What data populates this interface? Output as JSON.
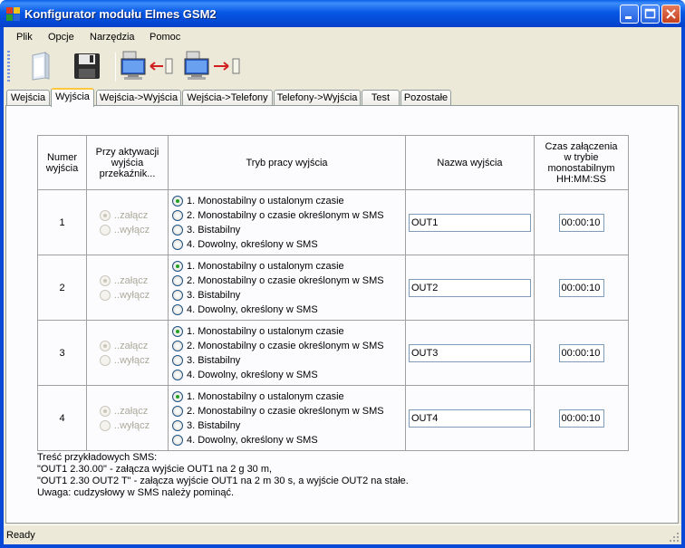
{
  "window": {
    "title": "Konfigurator modułu Elmes GSM2"
  },
  "menu": [
    "Plik",
    "Opcje",
    "Narzędzia",
    "Pomoc"
  ],
  "toolbar": {
    "buttons": [
      "open-icon",
      "save-icon",
      "read-from-device-icon",
      "write-to-device-icon"
    ]
  },
  "tabs": [
    "Wejścia",
    "Wyjścia",
    "Wejścia->Wyjścia",
    "Wejścia->Telefony",
    "Telefony->Wyjścia",
    "Test",
    "Pozostałe"
  ],
  "active_tab": "Wyjścia",
  "table": {
    "headers": {
      "number": "Numer wyjścia",
      "relay": "Przy aktywacji wyjścia przekaźnik...",
      "mode": "Tryb pracy wyjścia",
      "name": "Nazwa wyjścia",
      "time": "Czas załączenia w trybie monostabilnym HH:MM:SS"
    },
    "relay_options": [
      "..załącz",
      "..wyłącz"
    ],
    "mode_options": [
      "1. Monostabilny o ustalonym czasie",
      "2. Monostabilny o czasie określonym w SMS",
      "3. Bistabilny",
      "4. Dowolny, określony w SMS"
    ],
    "rows": [
      {
        "number": "1",
        "name": "OUT1",
        "time": "00:00:10"
      },
      {
        "number": "2",
        "name": "OUT2",
        "time": "00:00:10"
      },
      {
        "number": "3",
        "name": "OUT3",
        "time": "00:00:10"
      },
      {
        "number": "4",
        "name": "OUT4",
        "time": "00:00:10"
      }
    ]
  },
  "notes": [
    "Treść przykładowych SMS:",
    "\"OUT1 2.30.00\" - załącza wyjście OUT1 na 2 g 30 m,",
    "\"OUT1 2.30 OUT2 T\" - załącza wyjście OUT1 na 2 m 30 s, a wyjście OUT2 na stałe.",
    "Uwaga: cudzysłowy w SMS należy pominąć."
  ],
  "status": "Ready"
}
